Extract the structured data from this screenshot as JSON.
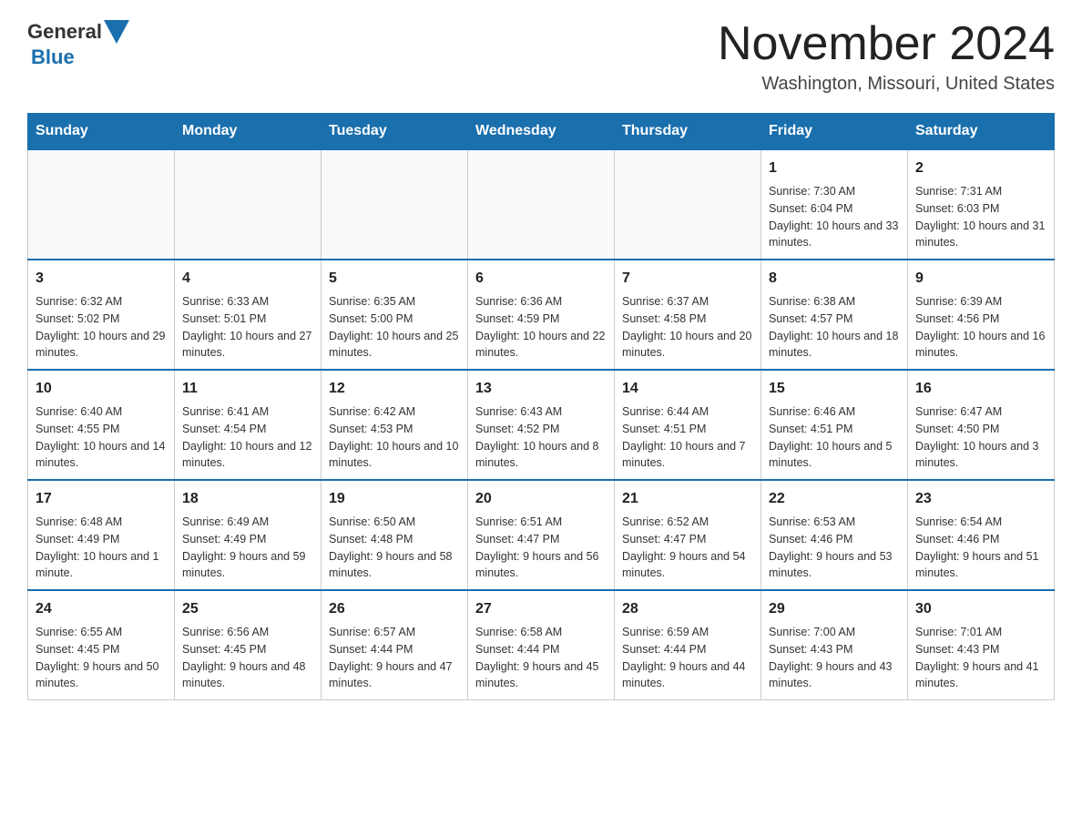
{
  "header": {
    "logo_general": "General",
    "logo_blue": "Blue",
    "month_title": "November 2024",
    "location": "Washington, Missouri, United States"
  },
  "weekdays": [
    "Sunday",
    "Monday",
    "Tuesday",
    "Wednesday",
    "Thursday",
    "Friday",
    "Saturday"
  ],
  "weeks": [
    [
      {
        "day": "",
        "info": ""
      },
      {
        "day": "",
        "info": ""
      },
      {
        "day": "",
        "info": ""
      },
      {
        "day": "",
        "info": ""
      },
      {
        "day": "",
        "info": ""
      },
      {
        "day": "1",
        "info": "Sunrise: 7:30 AM\nSunset: 6:04 PM\nDaylight: 10 hours and 33 minutes."
      },
      {
        "day": "2",
        "info": "Sunrise: 7:31 AM\nSunset: 6:03 PM\nDaylight: 10 hours and 31 minutes."
      }
    ],
    [
      {
        "day": "3",
        "info": "Sunrise: 6:32 AM\nSunset: 5:02 PM\nDaylight: 10 hours and 29 minutes."
      },
      {
        "day": "4",
        "info": "Sunrise: 6:33 AM\nSunset: 5:01 PM\nDaylight: 10 hours and 27 minutes."
      },
      {
        "day": "5",
        "info": "Sunrise: 6:35 AM\nSunset: 5:00 PM\nDaylight: 10 hours and 25 minutes."
      },
      {
        "day": "6",
        "info": "Sunrise: 6:36 AM\nSunset: 4:59 PM\nDaylight: 10 hours and 22 minutes."
      },
      {
        "day": "7",
        "info": "Sunrise: 6:37 AM\nSunset: 4:58 PM\nDaylight: 10 hours and 20 minutes."
      },
      {
        "day": "8",
        "info": "Sunrise: 6:38 AM\nSunset: 4:57 PM\nDaylight: 10 hours and 18 minutes."
      },
      {
        "day": "9",
        "info": "Sunrise: 6:39 AM\nSunset: 4:56 PM\nDaylight: 10 hours and 16 minutes."
      }
    ],
    [
      {
        "day": "10",
        "info": "Sunrise: 6:40 AM\nSunset: 4:55 PM\nDaylight: 10 hours and 14 minutes."
      },
      {
        "day": "11",
        "info": "Sunrise: 6:41 AM\nSunset: 4:54 PM\nDaylight: 10 hours and 12 minutes."
      },
      {
        "day": "12",
        "info": "Sunrise: 6:42 AM\nSunset: 4:53 PM\nDaylight: 10 hours and 10 minutes."
      },
      {
        "day": "13",
        "info": "Sunrise: 6:43 AM\nSunset: 4:52 PM\nDaylight: 10 hours and 8 minutes."
      },
      {
        "day": "14",
        "info": "Sunrise: 6:44 AM\nSunset: 4:51 PM\nDaylight: 10 hours and 7 minutes."
      },
      {
        "day": "15",
        "info": "Sunrise: 6:46 AM\nSunset: 4:51 PM\nDaylight: 10 hours and 5 minutes."
      },
      {
        "day": "16",
        "info": "Sunrise: 6:47 AM\nSunset: 4:50 PM\nDaylight: 10 hours and 3 minutes."
      }
    ],
    [
      {
        "day": "17",
        "info": "Sunrise: 6:48 AM\nSunset: 4:49 PM\nDaylight: 10 hours and 1 minute."
      },
      {
        "day": "18",
        "info": "Sunrise: 6:49 AM\nSunset: 4:49 PM\nDaylight: 9 hours and 59 minutes."
      },
      {
        "day": "19",
        "info": "Sunrise: 6:50 AM\nSunset: 4:48 PM\nDaylight: 9 hours and 58 minutes."
      },
      {
        "day": "20",
        "info": "Sunrise: 6:51 AM\nSunset: 4:47 PM\nDaylight: 9 hours and 56 minutes."
      },
      {
        "day": "21",
        "info": "Sunrise: 6:52 AM\nSunset: 4:47 PM\nDaylight: 9 hours and 54 minutes."
      },
      {
        "day": "22",
        "info": "Sunrise: 6:53 AM\nSunset: 4:46 PM\nDaylight: 9 hours and 53 minutes."
      },
      {
        "day": "23",
        "info": "Sunrise: 6:54 AM\nSunset: 4:46 PM\nDaylight: 9 hours and 51 minutes."
      }
    ],
    [
      {
        "day": "24",
        "info": "Sunrise: 6:55 AM\nSunset: 4:45 PM\nDaylight: 9 hours and 50 minutes."
      },
      {
        "day": "25",
        "info": "Sunrise: 6:56 AM\nSunset: 4:45 PM\nDaylight: 9 hours and 48 minutes."
      },
      {
        "day": "26",
        "info": "Sunrise: 6:57 AM\nSunset: 4:44 PM\nDaylight: 9 hours and 47 minutes."
      },
      {
        "day": "27",
        "info": "Sunrise: 6:58 AM\nSunset: 4:44 PM\nDaylight: 9 hours and 45 minutes."
      },
      {
        "day": "28",
        "info": "Sunrise: 6:59 AM\nSunset: 4:44 PM\nDaylight: 9 hours and 44 minutes."
      },
      {
        "day": "29",
        "info": "Sunrise: 7:00 AM\nSunset: 4:43 PM\nDaylight: 9 hours and 43 minutes."
      },
      {
        "day": "30",
        "info": "Sunrise: 7:01 AM\nSunset: 4:43 PM\nDaylight: 9 hours and 41 minutes."
      }
    ]
  ]
}
